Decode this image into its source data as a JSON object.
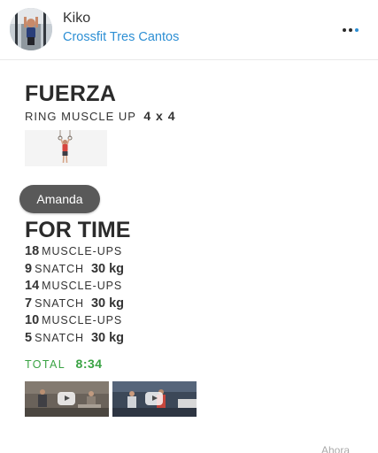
{
  "post": {
    "author": "Kiko",
    "gym": "Crossfit Tres Cantos",
    "more_icon": "more-dots-icon",
    "accent_color": "#2d8fd4"
  },
  "strength": {
    "title": "FUERZA",
    "exercise": "RING MUSCLE UP",
    "scheme": "4 x 4"
  },
  "wod": {
    "name": "Amanda",
    "format": "FOR TIME",
    "movements": [
      {
        "reps": "18",
        "name": "MUSCLE-UPS",
        "load": ""
      },
      {
        "reps": "9",
        "name": "SNATCH",
        "load": "30 kg"
      },
      {
        "reps": "14",
        "name": "MUSCLE-UPS",
        "load": ""
      },
      {
        "reps": "7",
        "name": "SNATCH",
        "load": "30 kg"
      },
      {
        "reps": "10",
        "name": "MUSCLE-UPS",
        "load": ""
      },
      {
        "reps": "5",
        "name": "SNATCH",
        "load": "30 kg"
      }
    ],
    "total_label": "TOTAL",
    "total_time": "8:34",
    "result_color": "#3aa344"
  },
  "videos": [
    {
      "icon": "play-icon"
    },
    {
      "icon": "play-icon"
    }
  ],
  "footer": {
    "timestamp": "Ahora"
  }
}
